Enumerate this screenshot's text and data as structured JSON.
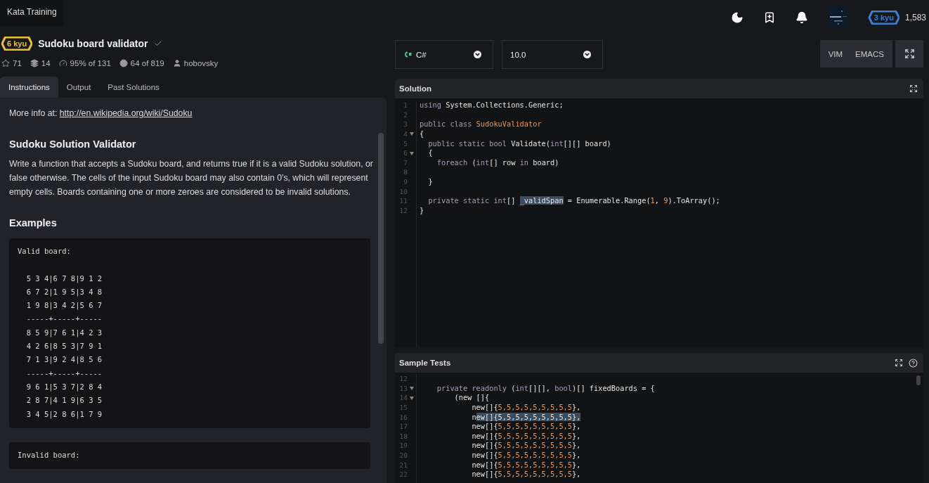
{
  "app_title": "Kata Training",
  "header": {
    "rank_badge": "3 kyu",
    "honor": "1,583"
  },
  "kata": {
    "rank": "6 kyu",
    "title": "Sudoku board validator",
    "completed": true,
    "stats": [
      {
        "kind": "stars",
        "text": "71"
      },
      {
        "kind": "collections",
        "text": "14"
      },
      {
        "kind": "satisfaction",
        "text": "95% of 131"
      },
      {
        "kind": "completions",
        "text": "64 of 819"
      },
      {
        "kind": "author",
        "text": "hobovsky"
      }
    ]
  },
  "tabs": [
    {
      "label": "Instructions",
      "selected": true
    },
    {
      "label": "Output",
      "selected": false
    },
    {
      "label": "Past Solutions",
      "selected": false
    }
  ],
  "instructions": {
    "more_info": {
      "label": "More info at:",
      "link": "http://en.wikipedia.org/wiki/Sudoku"
    },
    "heading": "Sudoku Solution Validator",
    "paragraph": "Write a function that accepts a Sudoku board, and returns true if it is a valid Sudoku solution, or false otherwise. The cells of the input Sudoku board may also contain 0's, which will represent empty cells. Boards containing one or more zeroes are considered to be invalid solutions.",
    "examples_heading": "Examples",
    "code_blocks": [
      {
        "title": "Valid board:",
        "lines": [
          "  5 3 4|6 7 8|9 1 2",
          "  6 7 2|1 9 5|3 4 8",
          "  1 9 8|3 4 2|5 6 7",
          "  -----+-----+-----",
          "  8 5 9|7 6 1|4 2 3",
          "  4 2 6|8 5 3|7 9 1",
          "  7 1 3|9 2 4|8 5 6",
          "  -----+-----+-----",
          "  9 6 1|5 3 7|2 8 4",
          "  2 8 7|4 1 9|6 3 5",
          "  3 4 5|2 8 6|1 7 9"
        ]
      },
      {
        "title": "Invalid board:"
      }
    ]
  },
  "editor": {
    "language": "C#",
    "version": "10.0",
    "modes": [
      "VIM",
      "EMACS"
    ]
  },
  "solution": {
    "title": "Solution",
    "lines": [
      {
        "number": "1",
        "foldable": false,
        "tokens": [
          {
            "text": "using",
            "kind": "keyword"
          },
          {
            "text": " System.Collections.Generic;",
            "kind": "plain"
          }
        ]
      },
      {
        "number": "2",
        "foldable": false
      },
      {
        "number": "3",
        "foldable": false,
        "tokens": [
          {
            "text": "public class ",
            "kind": "keyword"
          },
          {
            "text": "SudokuValidator",
            "kind": "class"
          }
        ]
      },
      {
        "number": "4",
        "foldable": true,
        "tokens": [
          {
            "text": "{",
            "kind": "plain"
          }
        ]
      },
      {
        "number": "5",
        "foldable": false,
        "tokens": [
          {
            "text": "  public static bool ",
            "kind": "keyword"
          },
          {
            "text": "Validate(",
            "kind": "plain"
          },
          {
            "text": "int",
            "kind": "keyword"
          },
          {
            "text": "[][] board)",
            "kind": "plain"
          }
        ]
      },
      {
        "number": "6",
        "foldable": true,
        "tokens": [
          {
            "text": "  {",
            "kind": "plain"
          }
        ]
      },
      {
        "number": "7",
        "foldable": false,
        "tokens": [
          {
            "text": "    foreach ",
            "kind": "keyword"
          },
          {
            "text": "(",
            "kind": "plain"
          },
          {
            "text": "int",
            "kind": "keyword"
          },
          {
            "text": "[] row ",
            "kind": "plain"
          },
          {
            "text": "in",
            "kind": "keyword"
          },
          {
            "text": " board)",
            "kind": "plain"
          }
        ]
      },
      {
        "number": "8",
        "foldable": false
      },
      {
        "number": "9",
        "foldable": false,
        "tokens": [
          {
            "text": "  }",
            "kind": "plain"
          }
        ]
      },
      {
        "number": "10",
        "foldable": false
      },
      {
        "number": "11",
        "foldable": false,
        "tokens": [
          {
            "text": "  private static int",
            "kind": "keyword"
          },
          {
            "text": "[] ",
            "kind": "plain"
          },
          {
            "text": "_validSpan",
            "kind": "selection"
          },
          {
            "text": " = Enumerable.Range(",
            "kind": "plain"
          },
          {
            "text": "1",
            "kind": "number"
          },
          {
            "text": ", ",
            "kind": "plain"
          },
          {
            "text": "9",
            "kind": "number"
          },
          {
            "text": ").ToArray();",
            "kind": "plain"
          }
        ]
      },
      {
        "number": "12",
        "foldable": false,
        "tokens": [
          {
            "text": "}",
            "kind": "plain"
          }
        ]
      }
    ]
  },
  "sample_tests": {
    "title": "Sample Tests",
    "lines": [
      {
        "number": "12",
        "foldable": false
      },
      {
        "number": "13",
        "foldable": true,
        "tokens": [
          {
            "text": "    private readonly ",
            "kind": "keyword"
          },
          {
            "text": "(",
            "kind": "plain"
          },
          {
            "text": "int",
            "kind": "keyword"
          },
          {
            "text": "[][], ",
            "kind": "plain"
          },
          {
            "text": "bool",
            "kind": "keyword"
          },
          {
            "text": ")[] fixedBoards = {",
            "kind": "plain"
          }
        ]
      },
      {
        "number": "14",
        "foldable": true,
        "tokens": [
          {
            "text": "        (new []{",
            "kind": "plain"
          }
        ]
      },
      {
        "number": "15",
        "foldable": false,
        "tokens": [
          {
            "text": "            new[]{",
            "kind": "plain"
          },
          {
            "text": "5,5,5,5,5,5,5,5,5",
            "kind": "number"
          },
          {
            "text": "},",
            "kind": "plain"
          }
        ]
      },
      {
        "number": "16",
        "foldable": false,
        "tokens": [
          {
            "text": "            n",
            "kind": "plain"
          },
          {
            "text": "ew[]{5,5,5,5,5,5,5,5,5},",
            "kind": "selection"
          }
        ]
      },
      {
        "number": "17",
        "foldable": false,
        "tokens": [
          {
            "text": "            new[]{",
            "kind": "plain"
          },
          {
            "text": "5,5,5,5,5,5,5,5,5",
            "kind": "number"
          },
          {
            "text": "},",
            "kind": "plain"
          }
        ]
      },
      {
        "number": "18",
        "foldable": false,
        "tokens": [
          {
            "text": "            new[]{",
            "kind": "plain"
          },
          {
            "text": "5,5,5,5,5,5,5,5,5",
            "kind": "number"
          },
          {
            "text": "},",
            "kind": "plain"
          }
        ]
      },
      {
        "number": "19",
        "foldable": false,
        "tokens": [
          {
            "text": "            new[]{",
            "kind": "plain"
          },
          {
            "text": "5,5,5,5,5,5,5,5,5",
            "kind": "number"
          },
          {
            "text": "},",
            "kind": "plain"
          }
        ]
      },
      {
        "number": "20",
        "foldable": false,
        "tokens": [
          {
            "text": "            new[]{",
            "kind": "plain"
          },
          {
            "text": "5,5,5,5,5,5,5,5,5",
            "kind": "number"
          },
          {
            "text": "},",
            "kind": "plain"
          }
        ]
      },
      {
        "number": "21",
        "foldable": false,
        "tokens": [
          {
            "text": "            new[]{",
            "kind": "plain"
          },
          {
            "text": "5,5,5,5,5,5,5,5,5",
            "kind": "number"
          },
          {
            "text": "},",
            "kind": "plain"
          }
        ]
      },
      {
        "number": "22",
        "foldable": false,
        "tokens": [
          {
            "text": "            new[]{",
            "kind": "plain"
          },
          {
            "text": "5,5,5,5,5,5,5,5,5",
            "kind": "number"
          },
          {
            "text": "},",
            "kind": "plain"
          }
        ]
      }
    ]
  }
}
